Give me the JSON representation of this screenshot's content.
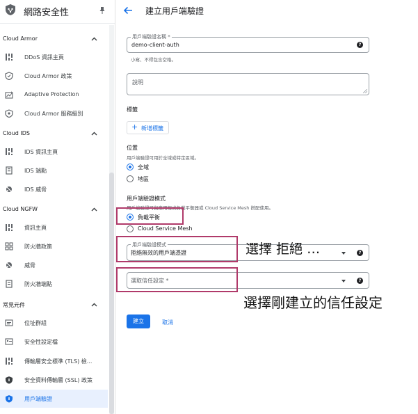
{
  "sidebar": {
    "title": "網路安全性",
    "sections": [
      {
        "label": "Cloud Armor",
        "items": [
          {
            "label": "DDoS 資訊主頁",
            "icon": "dashboard-icon"
          },
          {
            "label": "Cloud Armor 政策",
            "icon": "shield-policy-icon"
          },
          {
            "label": "Adaptive Protection",
            "icon": "adaptive-protection-icon"
          },
          {
            "label": "Cloud Armor 服務級別",
            "icon": "shield-tier-icon"
          }
        ]
      },
      {
        "label": "Cloud IDS",
        "items": [
          {
            "label": "IDS 資訊主頁",
            "icon": "dashboard-icon"
          },
          {
            "label": "IDS 端點",
            "icon": "endpoint-icon"
          },
          {
            "label": "IDS 威脅",
            "icon": "threat-icon"
          }
        ]
      },
      {
        "label": "Cloud NGFW",
        "items": [
          {
            "label": "資訊主頁",
            "icon": "dashboard-icon"
          },
          {
            "label": "防火牆政策",
            "icon": "firewall-policy-icon"
          },
          {
            "label": "威脅",
            "icon": "threat-icon"
          },
          {
            "label": "防火牆端點",
            "icon": "endpoint-icon"
          }
        ]
      },
      {
        "label": "常見元件",
        "items": [
          {
            "label": "位址群組",
            "icon": "address-group-icon"
          },
          {
            "label": "安全性設定檔",
            "icon": "security-profile-icon"
          },
          {
            "label": "傳輸層安全標準 (TLS) 檢...",
            "icon": "tls-inspection-icon"
          },
          {
            "label": "安全資料傳輸層 (SSL) 政策",
            "icon": "ssl-policy-shield-icon"
          },
          {
            "label": "用戶端驗證",
            "icon": "client-auth-shield-icon",
            "active": true
          }
        ]
      }
    ]
  },
  "header": {
    "title": "建立用戶端驗證"
  },
  "form": {
    "name_field": {
      "label": "用戶端驗證名稱 *",
      "value": "demo-client-auth",
      "hint": "小寫、不得包含空格。"
    },
    "description_field": {
      "label": "說明"
    },
    "labels": {
      "heading": "標籤",
      "add_button": "新增標籤"
    },
    "location": {
      "heading": "位置",
      "hint": "用戶端驗證可用於全域或特定區域。",
      "options": [
        {
          "label": "全域",
          "selected": true
        },
        {
          "label": "地區",
          "selected": false
        }
      ]
    },
    "auth_mode": {
      "heading": "用戶端驗證模式",
      "hint": "用戶端驗證可與應用程式負載平衡器或 Cloud Service Mesh 搭配使用。",
      "options": [
        {
          "label": "負載平衡",
          "selected": true
        },
        {
          "label": "Cloud Service Mesh",
          "selected": false
        }
      ]
    },
    "validation_mode": {
      "label": "用戶端驗證模式",
      "value": "拒絕無效的用戶端憑證"
    },
    "trust_config": {
      "placeholder": "選取信任設定 *"
    },
    "create_button": "建立",
    "cancel_button": "取消"
  },
  "annotations": {
    "select_reject": "選擇 拒絕 …",
    "select_trust": "選擇剛建立的信任設定"
  },
  "colors": {
    "accent": "#1a73e8",
    "highlight": "#b03a6a",
    "active_bg": "#e8f0fe"
  }
}
